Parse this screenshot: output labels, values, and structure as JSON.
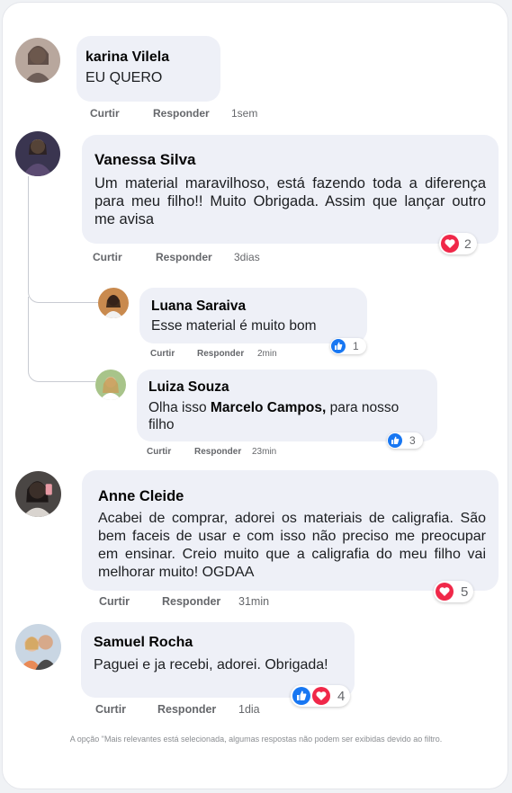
{
  "comments": [
    {
      "name": "karina Vilela",
      "text": "EU QUERO",
      "actions": {
        "like": "Curtir",
        "reply": "Responder",
        "time": "1sem"
      }
    },
    {
      "name": "Vanessa Silva",
      "text": "Um material maravilhoso, está fazendo toda a diferença para meu filho!! Muito Obrigada. Assim que lançar outro me avisa",
      "actions": {
        "like": "Curtir",
        "reply": "Responder",
        "time": "3dias"
      },
      "reactions": {
        "icons": [
          "heart-icon"
        ],
        "count": "2"
      }
    },
    {
      "name": "Luana Saraiva",
      "text": "Esse material é muito bom",
      "actions": {
        "like": "Curtir",
        "reply": "Responder",
        "time": "2min"
      },
      "reactions": {
        "icons": [
          "like-icon"
        ],
        "count": "1"
      }
    },
    {
      "name": "Luiza Souza",
      "text_before": "Olha isso ",
      "mention": "Marcelo Campos,",
      "text_after": " para nosso filho",
      "actions": {
        "like": "Curtir",
        "reply": "Responder",
        "time": "23min"
      },
      "reactions": {
        "icons": [
          "like-icon"
        ],
        "count": "3"
      }
    },
    {
      "name": "Anne Cleide",
      "text": "Acabei de comprar, adorei os materiais de caligrafia. São bem faceis de usar e com isso não preciso me preocupar em ensinar. Creio muito que a caligrafia do meu filho vai melhorar muito! OGDAA",
      "actions": {
        "like": "Curtir",
        "reply": "Responder",
        "time": "31min"
      },
      "reactions": {
        "icons": [
          "heart-icon"
        ],
        "count": "5"
      }
    },
    {
      "name": "Samuel Rocha",
      "text": "Paguei e ja recebi, adorei. Obrigada!",
      "actions": {
        "like": "Curtir",
        "reply": "Responder",
        "time": "1dia"
      },
      "reactions": {
        "icons": [
          "like-icon",
          "heart-icon"
        ],
        "count": "4"
      }
    }
  ],
  "footer": "A opção \"Mais relevantes está selecionada, algumas respostas não podem ser exibidas devido ao filtro.",
  "colors": {
    "like": "#1877f2",
    "heart": "#f02849",
    "bubble": "#eef0f7"
  }
}
